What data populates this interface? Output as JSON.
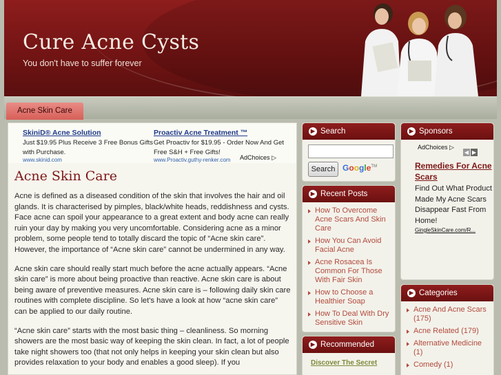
{
  "header": {
    "title": "Cure Acne Cysts",
    "tagline": "You don't have to suffer forever"
  },
  "nav": {
    "tabs": [
      {
        "label": "Acne Skin Care"
      }
    ]
  },
  "ads": {
    "items": [
      {
        "title": "SkiniD® Acne Solution",
        "text": "Just $19.95 Plus Receive 3 Free Bonus Gifts with Purchase.",
        "url": "www.skinid.com"
      },
      {
        "title": "Proactiv Acne Treatment ™",
        "text": "Get Proactiv for $19.95 - Order Now And Get Free S&H + Free Gifts!",
        "url": "www.Proactiv.guthy-renker.com"
      }
    ],
    "adchoices": "AdChoices"
  },
  "post": {
    "title": "Acne Skin Care",
    "paragraphs": [
      "Acne is defined as a diseased condition of the skin that involves the hair and oil glands. It is characterised by pimples, black/white heads, reddishness and cysts. Face acne can spoil your appearance to a great extent and body acne can really ruin your day by making you very uncomfortable. Considering acne as a minor problem, some people tend to totally discard the topic of “Acne skin care”. However, the importance of “Acne skin care” cannot be undermined in any way.",
      "Acne skin care should really start much before the acne actually appears. “Acne skin care” is more about being proactive than reactive. Acne skin care is about being aware of preventive measures. Acne skin care is – following daily skin care routines with complete discipline. So let's have a look at how “acne skin care” can be applied to our daily routine.",
      "“Acne skin care” starts with the most basic thing – cleanliness. So morning showers are the most basic way of keeping the skin clean. In fact, a lot of people take night showers too (that not only helps in keeping your skin clean but also provides relaxation to your body and enables a good sleep). If you"
    ]
  },
  "search": {
    "heading": "Search",
    "input_value": "",
    "button_label": "Search",
    "google_label": "Google"
  },
  "recent_posts": {
    "heading": "Recent Posts",
    "items": [
      "How To Overcome Acne Scars And Skin Care",
      "How You Can Avoid Facial Acne",
      "Acne Rosacea Is Common For Those With Fair Skin",
      "How to Choose a Healthier Soap",
      "How To Deal With Dry Sensitive Skin"
    ]
  },
  "recommended": {
    "heading": "Recommended",
    "link": "Discover The Secret"
  },
  "sponsors": {
    "heading": "Sponsors",
    "adchoices": "AdChoices",
    "ad_title": "Remedies For Acne Scars",
    "ad_text": "Find Out What Product Made My Acne Scars Disappear Fast From Home!",
    "ad_url": "GingleSkinCare.com/R..."
  },
  "categories": {
    "heading": "Categories",
    "items": [
      "Acne And Acne Scars (175)",
      "Acne Related (179)",
      "Alternative Medicine (1)",
      "Comedy (1)"
    ]
  },
  "colors": {
    "header_red": "#7a1616",
    "accent": "#7d1717",
    "link": "#b24a3e",
    "nav_tab": "#d75f58"
  }
}
